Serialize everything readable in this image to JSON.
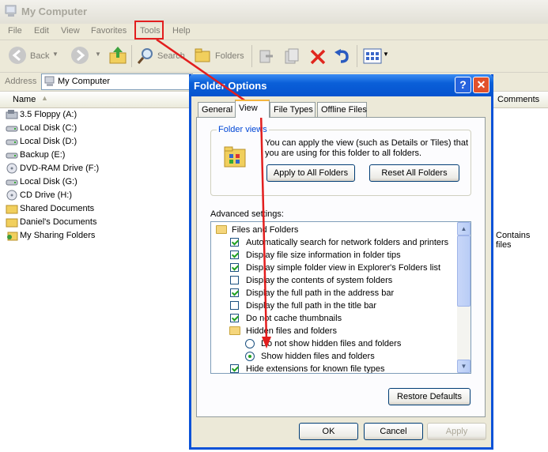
{
  "window": {
    "title": "My Computer"
  },
  "menu": [
    "File",
    "Edit",
    "View",
    "Favorites",
    "Tools",
    "Help"
  ],
  "toolbar": {
    "back": "Back",
    "search": "Search",
    "folders": "Folders"
  },
  "address": {
    "label": "Address",
    "value": "My Computer"
  },
  "columns": {
    "name": "Name",
    "comments": "Comments"
  },
  "items": [
    "3.5 Floppy (A:)",
    "Local Disk (C:)",
    "Local Disk (D:)",
    "Backup (E:)",
    "DVD-RAM Drive (F:)",
    "Local Disk (G:)",
    "CD Drive (H:)",
    "Shared Documents",
    "Daniel's Documents",
    "My Sharing Folders"
  ],
  "comment_text": "Contains files",
  "dialog": {
    "title": "Folder Options",
    "help_btn": "?",
    "close_btn": "✕",
    "tabs": [
      "General",
      "View",
      "File Types",
      "Offline Files"
    ],
    "folder_views": {
      "legend": "Folder views",
      "desc1": "You can apply the view (such as Details or Tiles) that",
      "desc2": "you are using for this folder to all folders.",
      "apply_btn": "Apply to All Folders",
      "reset_btn": "Reset All Folders"
    },
    "advanced_label": "Advanced settings:",
    "advanced": [
      {
        "label": "Files and Folders",
        "kind": "folder",
        "indent": 0
      },
      {
        "label": "Automatically search for network folders and printers",
        "kind": "check",
        "checked": true,
        "indent": 1
      },
      {
        "label": "Display file size information in folder tips",
        "kind": "check",
        "checked": true,
        "indent": 1
      },
      {
        "label": "Display simple folder view in Explorer's Folders list",
        "kind": "check",
        "checked": true,
        "indent": 1
      },
      {
        "label": "Display the contents of system folders",
        "kind": "check",
        "checked": false,
        "indent": 1
      },
      {
        "label": "Display the full path in the address bar",
        "kind": "check",
        "checked": true,
        "indent": 1
      },
      {
        "label": "Display the full path in the title bar",
        "kind": "check",
        "checked": false,
        "indent": 1
      },
      {
        "label": "Do not cache thumbnails",
        "kind": "check",
        "checked": true,
        "indent": 1
      },
      {
        "label": "Hidden files and folders",
        "kind": "folder",
        "indent": 1
      },
      {
        "label": "Do not show hidden files and folders",
        "kind": "radio",
        "checked": false,
        "indent": 2
      },
      {
        "label": "Show hidden files and folders",
        "kind": "radio",
        "checked": true,
        "indent": 2
      },
      {
        "label": "Hide extensions for known file types",
        "kind": "check",
        "checked": true,
        "indent": 1
      }
    ],
    "restore_btn": "Restore Defaults",
    "ok_btn": "OK",
    "cancel_btn": "Cancel",
    "apply_btn": "Apply"
  },
  "colors": {
    "annotation": "#e21e1e",
    "titlebar": "#0a5fd8"
  }
}
